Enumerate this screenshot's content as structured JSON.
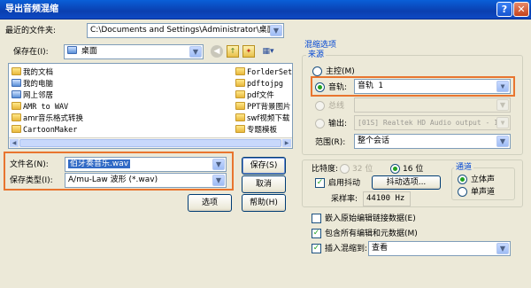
{
  "window": {
    "title": "导出音频混缩"
  },
  "recent": {
    "label": "最近的文件夹:",
    "value": "C:\\Documents and Settings\\Administrator\\桌面"
  },
  "savein": {
    "label": "保存在(I):",
    "value": "桌面"
  },
  "files": {
    "left": [
      "我的文档",
      "我的电脑",
      "网上邻居",
      "AMR to WAV",
      "amr音乐格式转换",
      "CartoonMaker"
    ],
    "right": [
      "ForlderSet",
      "pdftojpg",
      "pdf文件",
      "PPT背景图片",
      "swf视频下载",
      "专题模板"
    ]
  },
  "filename": {
    "label": "文件名(N):",
    "value": "伯牙奏音乐.wav"
  },
  "filetype": {
    "label": "保存类型(I):",
    "value": "A/mu-Law 波形 (*.wav)"
  },
  "buttons": {
    "save": "保存(S)",
    "cancel": "取消",
    "options": "选项",
    "help": "帮助(H)"
  },
  "mix": {
    "group_title": "混缩选项",
    "source_title": "来源",
    "master": "主控(M)",
    "track": "音轨:",
    "track_value": "音轨 1",
    "bus": "总线",
    "output": "输出:",
    "output_value": "[01S] Realtek HD Audio output - 1",
    "range": "范围(R):",
    "range_value": "整个会话"
  },
  "bitdepth": {
    "label": "比特度:",
    "opt32": "32 位",
    "opt16": "16 位",
    "dither": "启用抖动",
    "dither_options": "抖动选项...",
    "samplerate_label": "采样率:",
    "samplerate_value": "44100 Hz"
  },
  "channel": {
    "title": "通道",
    "stereo": "立体声",
    "mono": "单声道"
  },
  "extra": {
    "embed": "嵌入原始编辑链接数据(E)",
    "include_meta": "包含所有编辑和元数据(M)",
    "insert_mix": "插入混缩到:",
    "insert_target": "查看"
  },
  "icons": [
    "up-folder-icon",
    "new-folder-icon",
    "view-menu-icon",
    "back-icon",
    "help-icon",
    "close-icon"
  ]
}
